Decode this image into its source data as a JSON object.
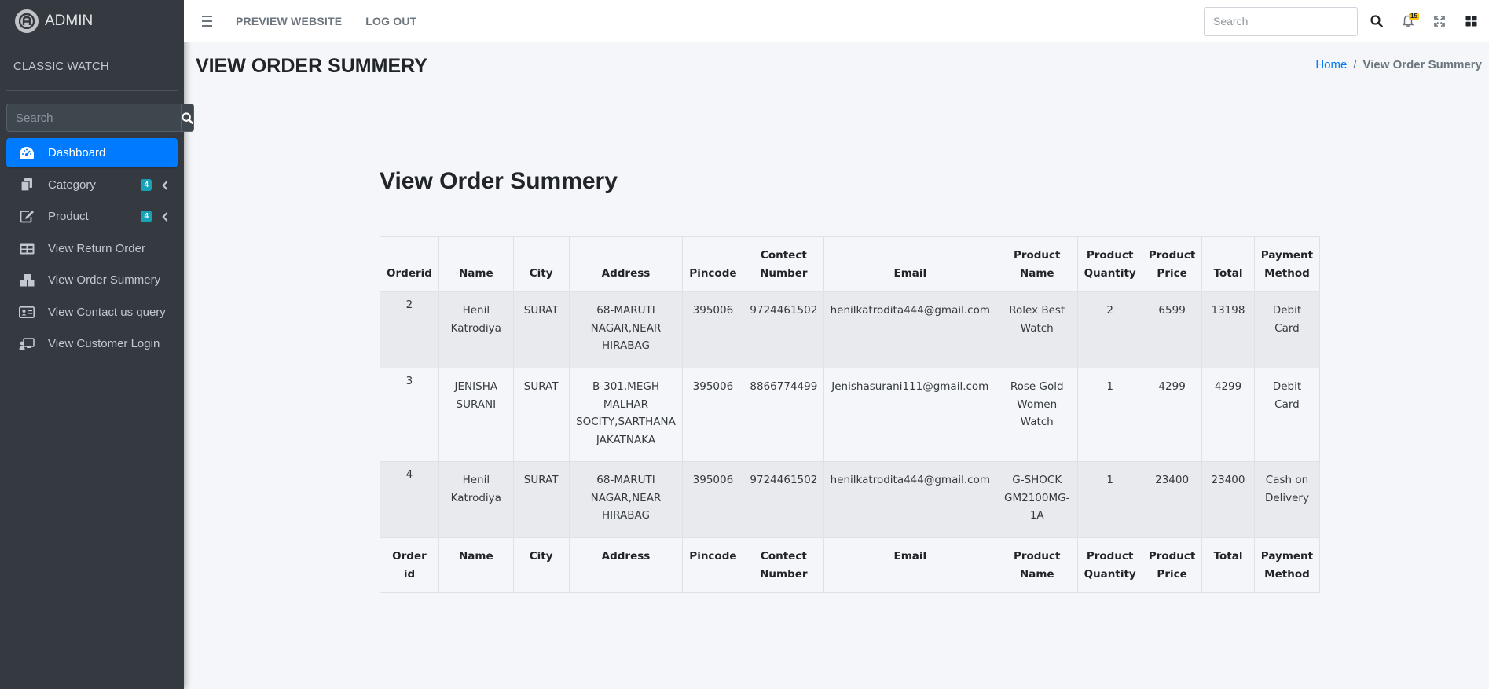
{
  "sidebar": {
    "brand": "ADMIN",
    "user_name": "CLASSIC WATCH",
    "search_placeholder": "Search",
    "items": [
      {
        "label": "Dashboard",
        "icon": "dashboard-icon",
        "active": true
      },
      {
        "label": "Category",
        "icon": "copy-icon",
        "badge": "4"
      },
      {
        "label": "Product",
        "icon": "edit-icon",
        "badge": "4"
      },
      {
        "label": "View Return Order",
        "icon": "table-icon"
      },
      {
        "label": "View Order Summery",
        "icon": "boxes-icon"
      },
      {
        "label": "View Contact us query",
        "icon": "id-card-icon"
      },
      {
        "label": "View Customer Login",
        "icon": "chalkboard-user-icon"
      }
    ]
  },
  "topbar": {
    "preview_label": "PREVIEW WEBSITE",
    "logout_label": "LOG OUT",
    "search_placeholder": "Search",
    "notification_count": "15"
  },
  "content": {
    "page_title": "VIEW ORDER SUMMERY",
    "breadcrumb": {
      "home": "Home",
      "separator": "/",
      "current": "View Order Summery"
    },
    "heading": "View Order Summery"
  },
  "table": {
    "headers": [
      "Orderid",
      "Name",
      "City",
      "Address",
      "Pincode",
      "Contect Number",
      "Email",
      "Product Name",
      "Product Quantity",
      "Product Price",
      "Total",
      "Payment Method"
    ],
    "footer_headers": [
      "Order id",
      "Name",
      "City",
      "Address",
      "Pincode",
      "Contect Number",
      "Email",
      "Product Name",
      "Product Quantity",
      "Product Price",
      "Total",
      "Payment Method"
    ],
    "rows": [
      [
        "2",
        "Henil Katrodiya",
        "SURAT",
        "68-MARUTI NAGAR,NEAR HIRABAG",
        "395006",
        "9724461502",
        "henilkatrodita444@gmail.com",
        "Rolex Best Watch",
        "2",
        "6599",
        "13198",
        "Debit Card"
      ],
      [
        "3",
        "JENISHA SURANI",
        "SURAT",
        "B-301,MEGH MALHAR SOCITY,SARTHANA JAKATNAKA",
        "395006",
        "8866774499",
        "Jenishasurani111@gmail.com",
        "Rose Gold Women Watch",
        "1",
        "4299",
        "4299",
        "Debit Card"
      ],
      [
        "4",
        "Henil Katrodiya",
        "SURAT",
        "68-MARUTI NAGAR,NEAR HIRABAG",
        "395006",
        "9724461502",
        "henilkatrodita444@gmail.com",
        "G-SHOCK GM2100MG-1A",
        "1",
        "23400",
        "23400",
        "Cash on Delivery"
      ]
    ]
  }
}
